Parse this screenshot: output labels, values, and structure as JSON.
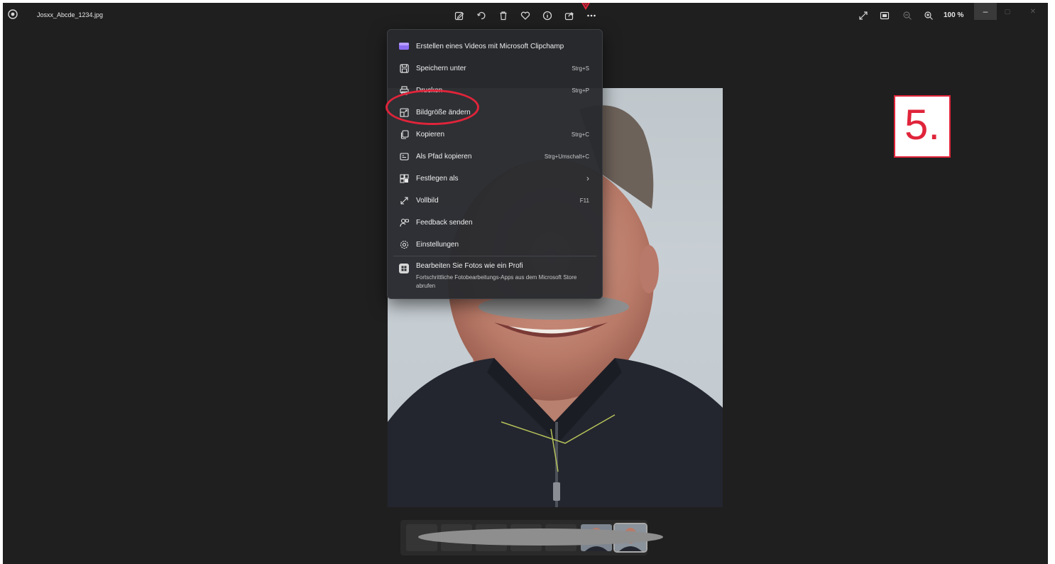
{
  "window": {
    "file_name": "Josxx_Abcde_1234.jpg",
    "zoom_level": "100 %",
    "minimize_glyph": "–",
    "maximize_glyph": "▢",
    "close_glyph": "✕"
  },
  "toolbar": {
    "center_icons": [
      "edit-icon",
      "rotate-icon",
      "delete-icon",
      "favorite-icon",
      "info-icon",
      "share-icon",
      "more-options-icon"
    ],
    "right_icons": [
      "fullscreen-icon",
      "fit-to-window-icon",
      "zoom-out-icon",
      "zoom-in-icon"
    ]
  },
  "more_menu": {
    "items": [
      {
        "label": "Erstellen eines Videos mit Microsoft Clipchamp",
        "shortcut": "",
        "icon": "clipchamp-icon"
      },
      {
        "label": "Speichern unter",
        "shortcut": "Strg+S",
        "icon": "save-icon"
      },
      {
        "label": "Drucken",
        "shortcut": "Strg+P",
        "icon": "print-icon"
      },
      {
        "label": "Bildgröße ändern",
        "shortcut": "",
        "icon": "resize-icon"
      },
      {
        "label": "Kopieren",
        "shortcut": "Strg+C",
        "icon": "copy-icon"
      },
      {
        "label": "Als Pfad kopieren",
        "shortcut": "Strg+Umschalt+C",
        "icon": "copy-path-icon"
      },
      {
        "label": "Festlegen als",
        "shortcut": "›",
        "icon": "set-as-icon"
      },
      {
        "label": "Vollbild",
        "shortcut": "F11",
        "icon": "fullscreen-icon"
      },
      {
        "label": "Feedback senden",
        "shortcut": "",
        "icon": "feedback-icon"
      },
      {
        "label": "Einstellungen",
        "shortcut": "",
        "icon": "settings-icon"
      }
    ],
    "promo": {
      "title": "Bearbeiten Sie Fotos wie ein Profi",
      "description": "Fortschrittliche Fotobearbeitungs-Apps aus dem Microsoft Store abrufen",
      "icon": "store-icon"
    }
  },
  "annotation": {
    "step_label": "5.",
    "color": "#e0243a"
  },
  "colors": {
    "background": "#1f1f1f",
    "menu": "#2a2c30",
    "text": "#f0f0f0"
  },
  "filmstrip": {
    "thumbnail_count": 7,
    "selected_index": 6
  }
}
